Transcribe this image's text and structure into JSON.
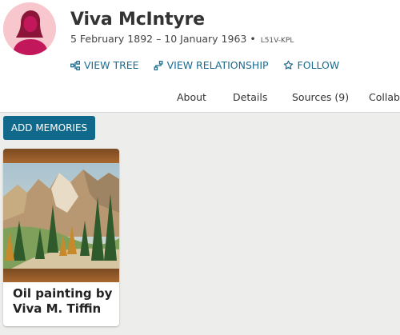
{
  "person": {
    "name": "Viva McIntyre",
    "dates": "5 February 1892 – 10 January 1963 •",
    "pid": "L51V-KPL"
  },
  "actions": {
    "view_tree": "VIEW TREE",
    "view_relationship": "VIEW RELATIONSHIP",
    "follow": "FOLLOW"
  },
  "tabs": [
    "About",
    "Details",
    "Sources (9)",
    "Collabo"
  ],
  "memories": {
    "add_label": "ADD MEMORIES",
    "items": [
      {
        "title": "Oil painting by Viva M. Tiffin"
      }
    ]
  },
  "colors": {
    "accent": "#10698a",
    "link": "#1b6a8f",
    "avatar_bg": "#f7c7cd",
    "avatar_figure": "#c2185b"
  },
  "icons": {
    "view_tree": "tree-icon",
    "view_relationship": "relationship-icon",
    "follow": "star-icon"
  }
}
